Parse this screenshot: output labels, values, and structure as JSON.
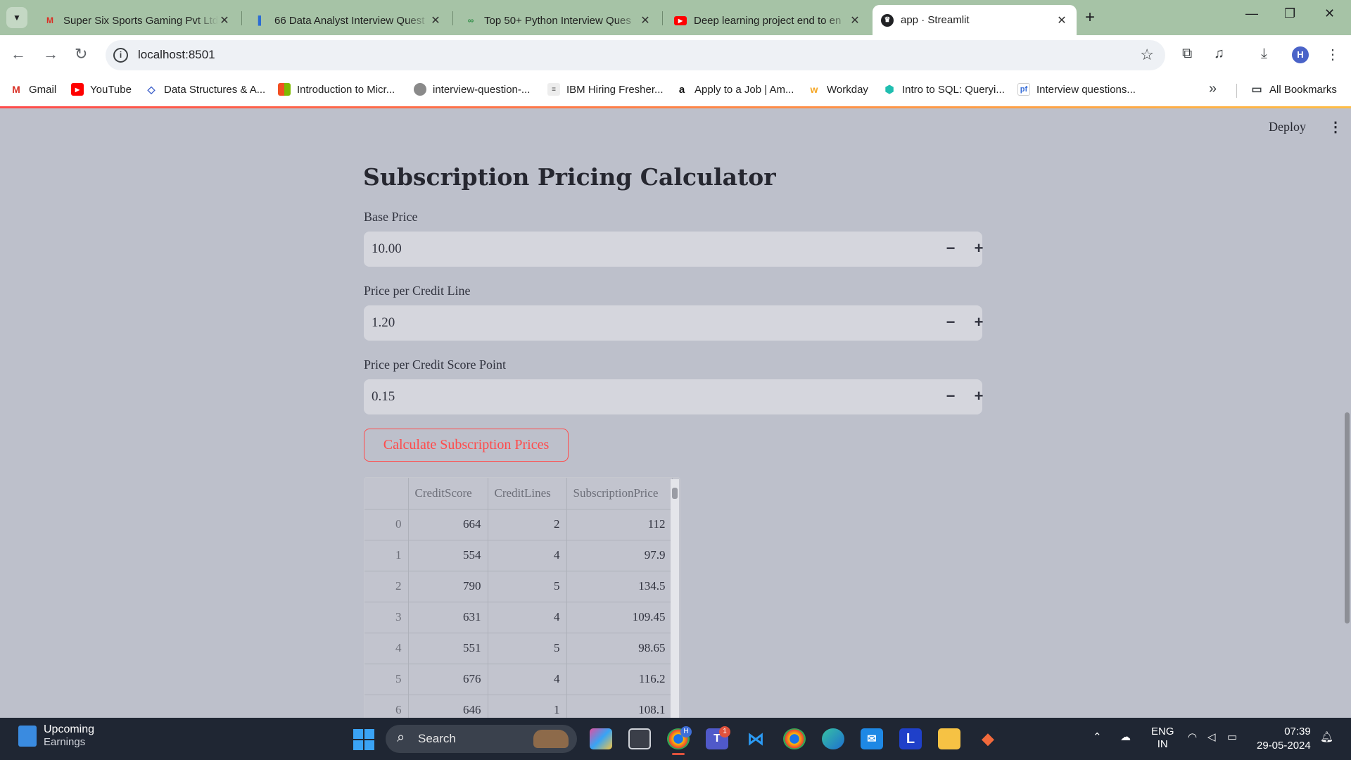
{
  "browser": {
    "tabs": [
      {
        "title": "Super Six Sports Gaming Pvt Ltd",
        "favicon": "gmail-icon"
      },
      {
        "title": "66 Data Analyst Interview Quest",
        "favicon": "bookmark-icon"
      },
      {
        "title": "Top 50+ Python Interview Ques",
        "favicon": "geeksforgeeks-icon"
      },
      {
        "title": "Deep learning project end to en",
        "favicon": "youtube-icon"
      },
      {
        "title": "app · Streamlit",
        "favicon": "streamlit-icon"
      }
    ],
    "url": "localhost:8501",
    "profile_initial": "H",
    "bookmarks": [
      {
        "label": "Gmail"
      },
      {
        "label": "YouTube"
      },
      {
        "label": "Data Structures & A..."
      },
      {
        "label": "Introduction to Micr..."
      },
      {
        "label": "interview-question-..."
      },
      {
        "label": "IBM Hiring Fresher..."
      },
      {
        "label": "Apply to a Job | Am..."
      },
      {
        "label": "Workday"
      },
      {
        "label": "Intro to SQL: Queryi..."
      },
      {
        "label": "Interview questions..."
      }
    ],
    "all_bookmarks": "All Bookmarks"
  },
  "app": {
    "deploy_label": "Deploy",
    "title": "Subscription Pricing Calculator",
    "inputs": [
      {
        "label": "Base Price",
        "value": "10.00"
      },
      {
        "label": "Price per Credit Line",
        "value": "1.20"
      },
      {
        "label": "Price per Credit Score Point",
        "value": "0.15"
      }
    ],
    "calculate_label": "Calculate Subscription Prices",
    "table": {
      "columns": [
        "",
        "CreditScore",
        "CreditLines",
        "SubscriptionPrice"
      ],
      "rows": [
        [
          "0",
          "664",
          "2",
          "112"
        ],
        [
          "1",
          "554",
          "4",
          "97.9"
        ],
        [
          "2",
          "790",
          "5",
          "134.5"
        ],
        [
          "3",
          "631",
          "4",
          "109.45"
        ],
        [
          "4",
          "551",
          "5",
          "98.65"
        ],
        [
          "5",
          "676",
          "4",
          "116.2"
        ],
        [
          "6",
          "646",
          "1",
          "108.1"
        ]
      ]
    }
  },
  "taskbar": {
    "widget_title": "Upcoming",
    "widget_subtitle": "Earnings",
    "search_label": "Search",
    "teams_badge": "1",
    "chrome_badge": "H",
    "lang_top": "ENG",
    "lang_bottom": "IN",
    "time": "07:39",
    "date": "29-05-2024"
  }
}
